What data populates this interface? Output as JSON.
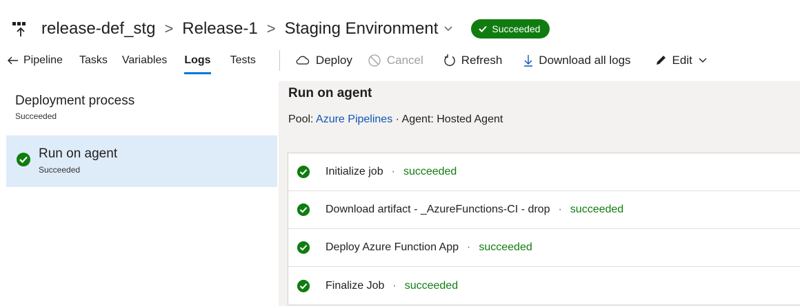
{
  "header": {
    "breadcrumb": [
      "release-def_stg",
      "Release-1",
      "Staging Environment"
    ],
    "status_badge": "Succeeded",
    "colors": {
      "success": "#107c10",
      "accent": "#0078d4",
      "link": "#0f55b5"
    }
  },
  "toolbar": {
    "back_label": "Pipeline",
    "tabs": [
      "Tasks",
      "Variables",
      "Logs",
      "Tests"
    ],
    "active_tab": "Logs",
    "actions": [
      {
        "label": "Deploy",
        "icon": "cloud-icon",
        "enabled": true
      },
      {
        "label": "Cancel",
        "icon": "cancel-icon",
        "enabled": false
      },
      {
        "label": "Refresh",
        "icon": "refresh-icon",
        "enabled": true
      },
      {
        "label": "Download all logs",
        "icon": "download-icon",
        "enabled": true
      },
      {
        "label": "Edit",
        "icon": "pencil-icon",
        "enabled": true
      }
    ]
  },
  "sidebar": {
    "title": "Deployment process",
    "status": "Succeeded",
    "items": [
      {
        "label": "Run on agent",
        "status": "Succeeded",
        "selected": true
      }
    ]
  },
  "main": {
    "title": "Run on agent",
    "pool_label": "Pool:",
    "pool_value": "Azure Pipelines",
    "agent_text": "· Agent: Hosted Agent",
    "separator": "·",
    "steps": [
      {
        "name": "Initialize job",
        "status": "succeeded"
      },
      {
        "name": "Download artifact - _AzureFunctions-CI - drop",
        "status": "succeeded"
      },
      {
        "name": "Deploy Azure Function App",
        "status": "succeeded"
      },
      {
        "name": "Finalize Job",
        "status": "succeeded"
      }
    ]
  }
}
